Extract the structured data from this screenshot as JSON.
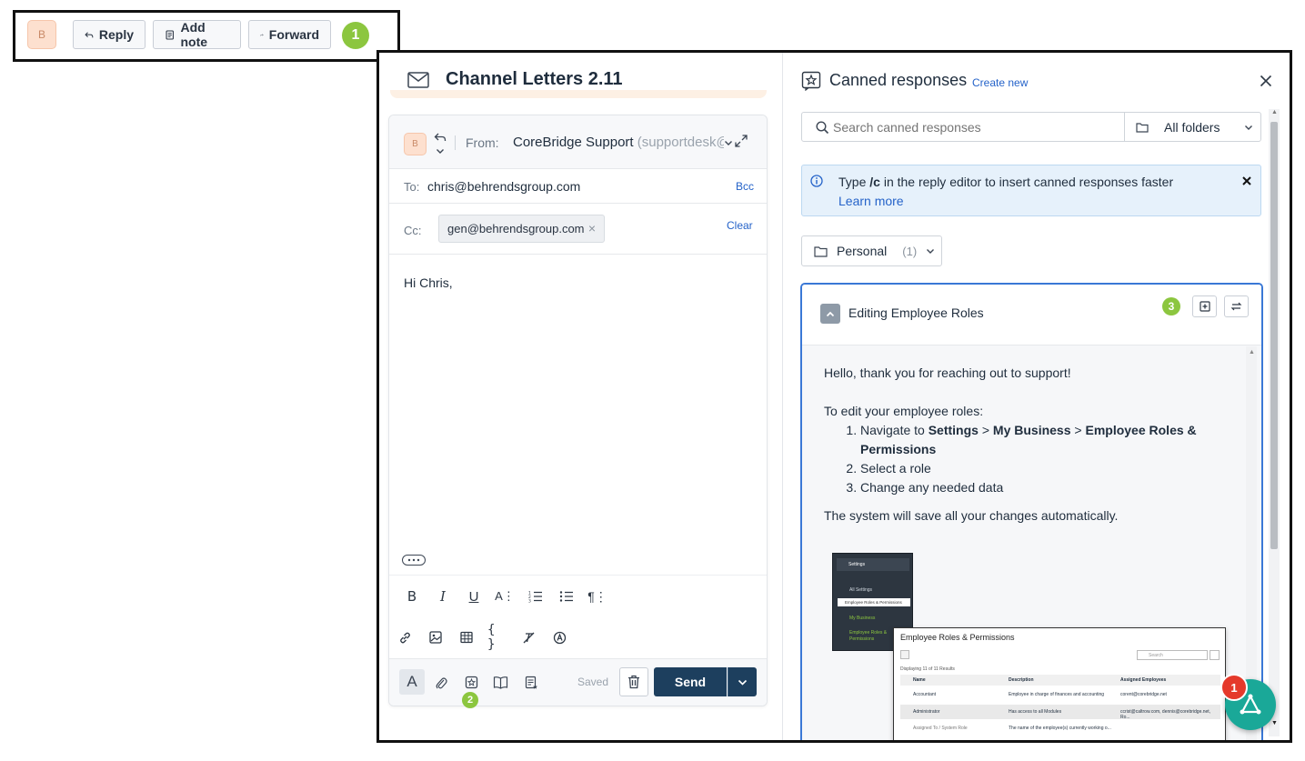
{
  "toolbar": {
    "avatar_initial": "B",
    "reply_label": "Reply",
    "add_note_label": "Add note",
    "forward_label": "Forward",
    "step": "1"
  },
  "conversation": {
    "title": "Channel Letters 2.11"
  },
  "composer": {
    "avatar_initial": "B",
    "from_label": "From:",
    "from_name": "CoreBridge Support",
    "from_email": "(supportdesk@co",
    "to_label": "To:",
    "to_value": "chris@behrendsgroup.com",
    "bcc_label": "Bcc",
    "cc_label": "Cc:",
    "cc_chip": "gen@behrendsgroup.com",
    "cc_chip_remove": "×",
    "clear_label": "Clear",
    "body": "Hi Chris,",
    "saved_label": "Saved",
    "send_label": "Send",
    "step": "2"
  },
  "canned": {
    "title": "Canned responses",
    "create_new": "Create new",
    "search_placeholder": "Search canned responses",
    "folder_select": "All folders",
    "info_text_pre": "Type ",
    "info_shortcut": "/c",
    "info_text_post": " in the reply editor to insert canned responses faster",
    "learn_more": "Learn more",
    "folder_name": "Personal",
    "folder_count": "(1)",
    "response_title": "Editing Employee Roles",
    "step": "3",
    "body_greeting": "Hello, thank you for reaching out to support!",
    "body_intro": "To edit your employee roles:",
    "step1_pre": "Navigate to ",
    "step1_b1": "Settings",
    "step1_sep1": " > ",
    "step1_b2": "My Business",
    "step1_sep2": " > ",
    "step1_b3": "Employee Roles & Permissions",
    "step2": "Select a role",
    "step3": "Change any needed data",
    "body_outro": "The system will save all your changes automatically.",
    "shot_menu": {
      "settings": "Settings",
      "all_settings": "All Settings",
      "roles": "Employee Roles & Permissions",
      "my_business": "My Business",
      "roles2": "Employee Roles & Permissions"
    },
    "shot_table": {
      "title": "Employee Roles & Permissions",
      "search": "Search",
      "displaying": "Displaying 11 of 11 Results",
      "col_name": "Name",
      "col_desc": "Description",
      "col_assigned": "Assigned Employees",
      "row1_name": "Accountant",
      "row1_desc": "Employee in charge of finances and accounting",
      "row1_assigned": "corent@corebridge.net",
      "row2_name": "Administrator",
      "row2_desc": "Has access to all Modules",
      "row2_assigned": "ccrist@caltrow.com, dennis@corebridge.net, Ro...",
      "row3_name": "Assigned To / System Role",
      "row3_desc": "The name of the employee(s) currently working o..."
    }
  },
  "fab": {
    "badge": "1"
  },
  "colors": {
    "accent_green": "#8cc63f",
    "send_navy": "#1d3f5e",
    "link_blue": "#2563c9",
    "fab_teal": "#1aa898",
    "badge_red": "#e5392b"
  }
}
